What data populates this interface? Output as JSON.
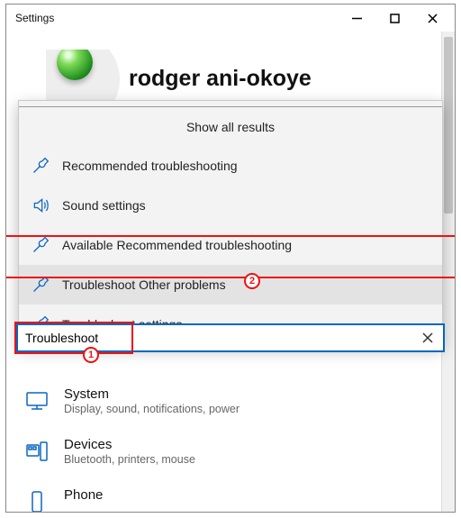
{
  "window": {
    "title": "Settings"
  },
  "profile": {
    "name": "rodger ani-okoye"
  },
  "dropdown": {
    "header": "Show all results",
    "items": [
      {
        "icon": "wrench-icon",
        "label": "Recommended troubleshooting"
      },
      {
        "icon": "sound-icon",
        "label": "Sound settings"
      },
      {
        "icon": "wrench-icon",
        "label": "Available Recommended troubleshooting"
      },
      {
        "icon": "wrench-icon",
        "label": "Troubleshoot Other problems",
        "highlight": true
      },
      {
        "icon": "wrench-icon",
        "label": "Troubleshoot settings"
      }
    ]
  },
  "search": {
    "value": "Troubleshoot"
  },
  "annotations": {
    "badge1": "1",
    "badge2": "2"
  },
  "categories": [
    {
      "icon": "system-icon",
      "title": "System",
      "sub": "Display, sound, notifications, power"
    },
    {
      "icon": "devices-icon",
      "title": "Devices",
      "sub": "Bluetooth, printers, mouse"
    },
    {
      "icon": "phone-icon",
      "title": "Phone",
      "sub": ""
    }
  ]
}
